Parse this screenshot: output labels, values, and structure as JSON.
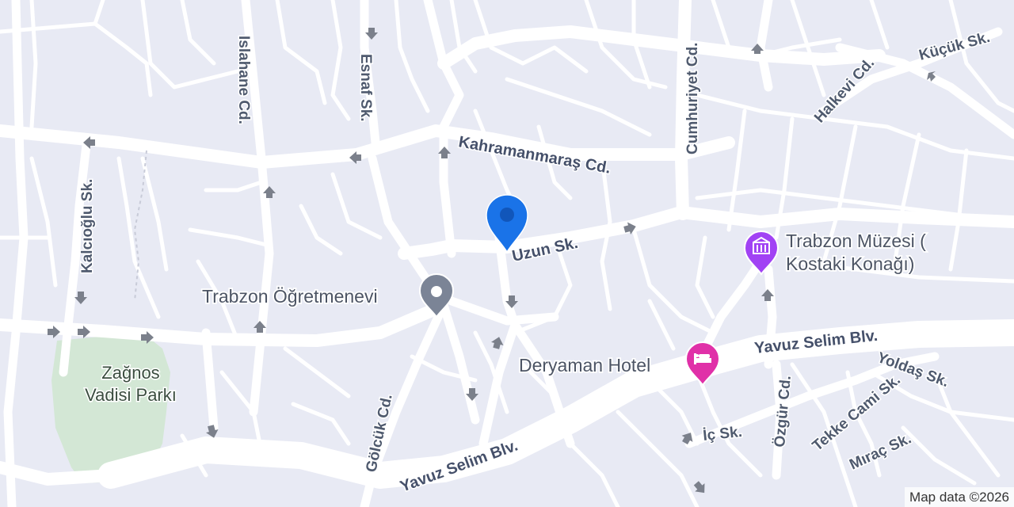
{
  "map": {
    "streets": {
      "islahane": "Islahane Cd.",
      "esnaf": "Esnaf Sk.",
      "cumhuriyet": "Cumhuriyet Cd.",
      "halkevi": "Halkevi Cd.",
      "kucuk": "Küçük Sk.",
      "kahramanmaras": "Kahramanmaraş Cd.",
      "kalcioglu": "Kalcıoğlu Sk.",
      "uzun": "Uzun Sk.",
      "yavuz_selim_1": "Yavuz Selim Blv.",
      "yavuz_selim_2": "Yavuz Selim Blv.",
      "golcuk": "Gölcük Cd.",
      "yoldas": "Yoldaş Sk.",
      "tekke_cami": "Tekke Cami Sk.",
      "ozgur": "Özgür Cd.",
      "ic": "İç Sk.",
      "mirac": "Mıraç Sk."
    },
    "pois": {
      "ogretmenevi": "Trabzon Öğretmenevi",
      "muzesi_line1": "Trabzon Müzesi (",
      "muzesi_line2": "Kostaki Konağı)",
      "deryaman": "Deryaman Hotel",
      "park_line1": "Zağnos",
      "park_line2": "Vadisi Parkı"
    },
    "icons": {
      "location_pin": "location-pin-icon",
      "generic_poi": "place-icon",
      "museum": "museum-icon",
      "hotel": "hotel-icon"
    },
    "colors": {
      "background": "#e8eaf4",
      "road": "#ffffff",
      "park": "#d3e7d5",
      "pin": "#1a73e8",
      "museum": "#a142f4",
      "hotel": "#e030a8",
      "label": "#4f5a6e"
    },
    "copyright": "Map data ©2026"
  }
}
